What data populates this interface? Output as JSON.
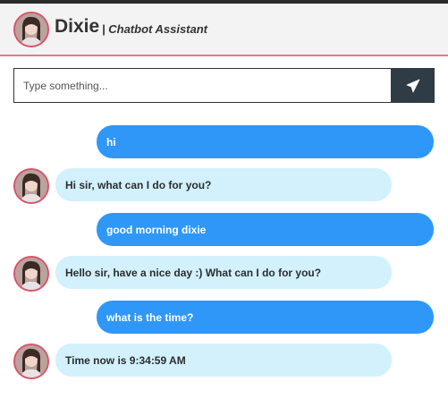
{
  "header": {
    "name": "Dixie",
    "subtitle": "| Chatbot Assistant"
  },
  "composer": {
    "placeholder": "Type something...",
    "send_icon": "paper-plane-icon"
  },
  "messages": [
    {
      "sender": "user",
      "text": "hi"
    },
    {
      "sender": "bot",
      "text": "Hi sir, what can I do for you?"
    },
    {
      "sender": "user",
      "text": "good morning dixie"
    },
    {
      "sender": "bot",
      "text": "Hello sir, have a nice day :) What can I do for you?"
    },
    {
      "sender": "user",
      "text": "what is the time?"
    },
    {
      "sender": "bot",
      "text": "Time now is 9:34:59 AM"
    }
  ],
  "colors": {
    "user_bubble": "#2f97f7",
    "bot_bubble": "#d2f1fc",
    "avatar_border": "#d9546b",
    "send_button": "#2f3b45"
  }
}
